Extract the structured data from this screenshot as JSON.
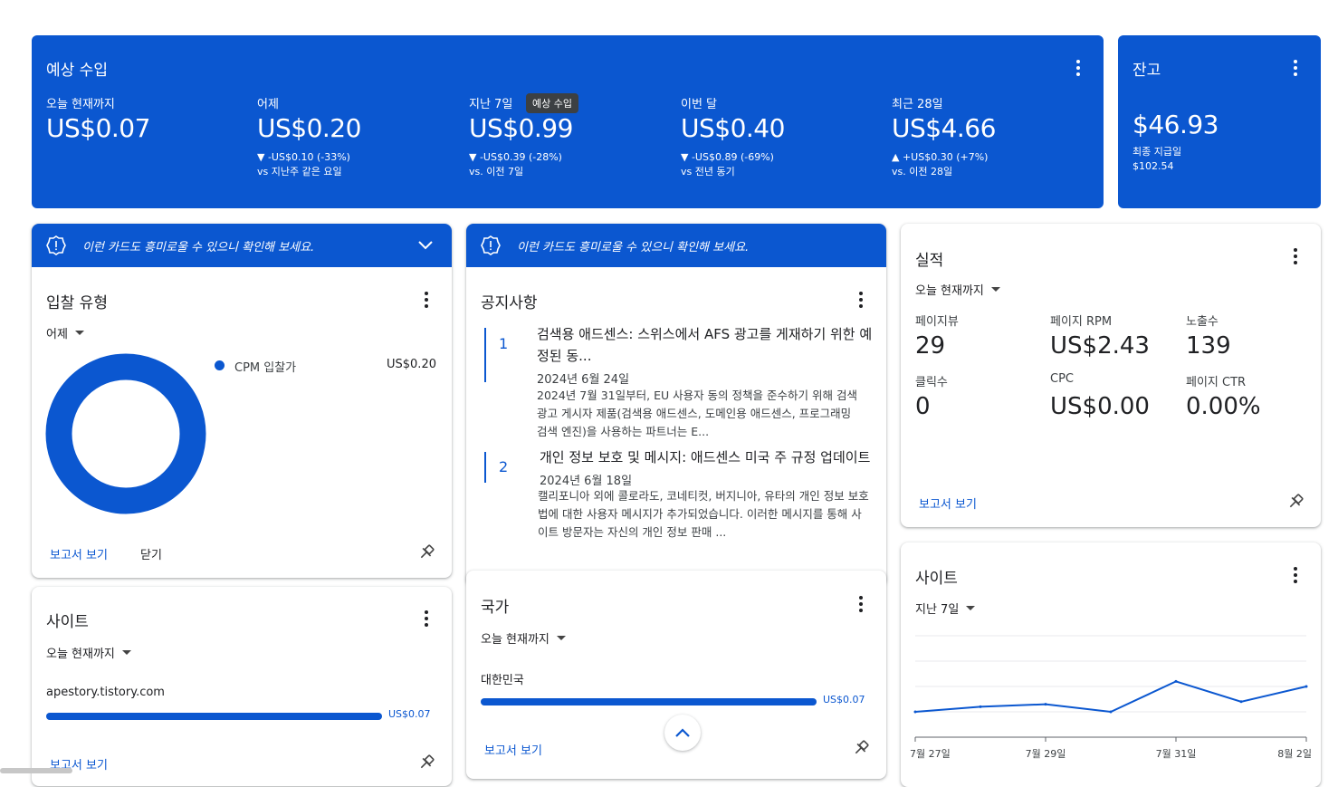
{
  "colors": {
    "accent": "#0b57d0",
    "text": "#202124"
  },
  "earnings": {
    "title": "예상 수입",
    "tooltip": "예상 수입",
    "metrics": [
      {
        "label": "오늘 현재까지",
        "value": "US$0.07",
        "delta": "",
        "compare": ""
      },
      {
        "label": "어제",
        "value": "US$0.20",
        "delta": "▼ -US$0.10 (-33%)",
        "compare": "vs 지난주 같은 요일"
      },
      {
        "label": "지난 7일",
        "value": "US$0.99",
        "delta": "▼ -US$0.39 (-28%)",
        "compare": "vs. 이전 7일"
      },
      {
        "label": "이번 달",
        "value": "US$0.40",
        "delta": "▼ -US$0.89 (-69%)",
        "compare": "vs 전년 동기"
      },
      {
        "label": "최근 28일",
        "value": "US$4.66",
        "delta": "▲ +US$0.30 (+7%)",
        "compare": "vs. 이전 28일"
      }
    ]
  },
  "balance": {
    "title": "잔고",
    "value": "$46.93",
    "last_payment_label": "최종 지급일",
    "last_payment_value": "$102.54"
  },
  "banner_text": "이런 카드도 흥미로울 수 있으니 확인해 보세요.",
  "bid_type": {
    "title": "입찰 유형",
    "period": "어제",
    "legend_label": "CPM 입찰가",
    "legend_value": "US$0.20",
    "donut_share": 1.0,
    "report_link": "보고서 보기",
    "close_link": "닫기"
  },
  "sites_left": {
    "title": "사이트",
    "period": "오늘 현재까지",
    "site_name": "apestory.tistory.com",
    "site_value": "US$0.07",
    "bar_share": 1.0,
    "report_link": "보고서 보기"
  },
  "notices": {
    "title": "공지사항",
    "items": [
      {
        "num": "1",
        "title": "검색용 애드센스: 스위스에서 AFS 광고를 게재하기 위한 예정된 동...",
        "date": "2024년 6월 24일",
        "body": "2024년 7월 31일부터, EU 사용자 동의 정책을 준수하기 위해 검색 광고 게시자 제품(검색용 애드센스, 도메인용 애드센스, 프로그래밍 검색 엔진)을 사용하는 파트너는 E..."
      },
      {
        "num": "2",
        "title": "개인 정보 보호 및 메시지: 애드센스 미국 주 규정 업데이트",
        "date": "2024년 6월 18일",
        "body": "캘리포니아 외에 콜로라도, 코네티컷, 버지니아, 유타의 개인 정보 보호법에 대한 사용자 메시지가 추가되었습니다. 이러한 메시지를 통해 사이트 방문자는 자신의 개인 정보 판매 ..."
      }
    ]
  },
  "country": {
    "title": "국가",
    "period": "오늘 현재까지",
    "country_name": "대한민국",
    "country_value": "US$0.07",
    "bar_share": 1.0,
    "report_link": "보고서 보기"
  },
  "performance": {
    "title": "실적",
    "period": "오늘 현재까지",
    "stats": [
      {
        "label": "페이지뷰",
        "value": "29"
      },
      {
        "label": "페이지 RPM",
        "value": "US$2.43"
      },
      {
        "label": "노출수",
        "value": "139"
      },
      {
        "label": "클릭수",
        "value": "0"
      },
      {
        "label": "CPC",
        "value": "US$0.00"
      },
      {
        "label": "페이지 CTR",
        "value": "0.00%"
      }
    ],
    "report_link": "보고서 보기"
  },
  "sites_right": {
    "title": "사이트",
    "period": "지난 7일",
    "x_labels": [
      "7월 27일",
      "7월 29일",
      "7월 31일",
      "8월 2일"
    ]
  },
  "chart_data": {
    "type": "line",
    "x": [
      "7월 27일",
      "7월 28일",
      "7월 29일",
      "7월 30일",
      "7월 31일",
      "8월 1일",
      "8월 2일"
    ],
    "tick_labels": [
      "7월 27일",
      "7월 29일",
      "7월 31일",
      "8월 2일"
    ],
    "series": [
      {
        "values": [
          0.1,
          0.12,
          0.13,
          0.1,
          0.22,
          0.14,
          0.2
        ]
      }
    ],
    "ylim": [
      0,
      0.4
    ],
    "grid": true
  }
}
